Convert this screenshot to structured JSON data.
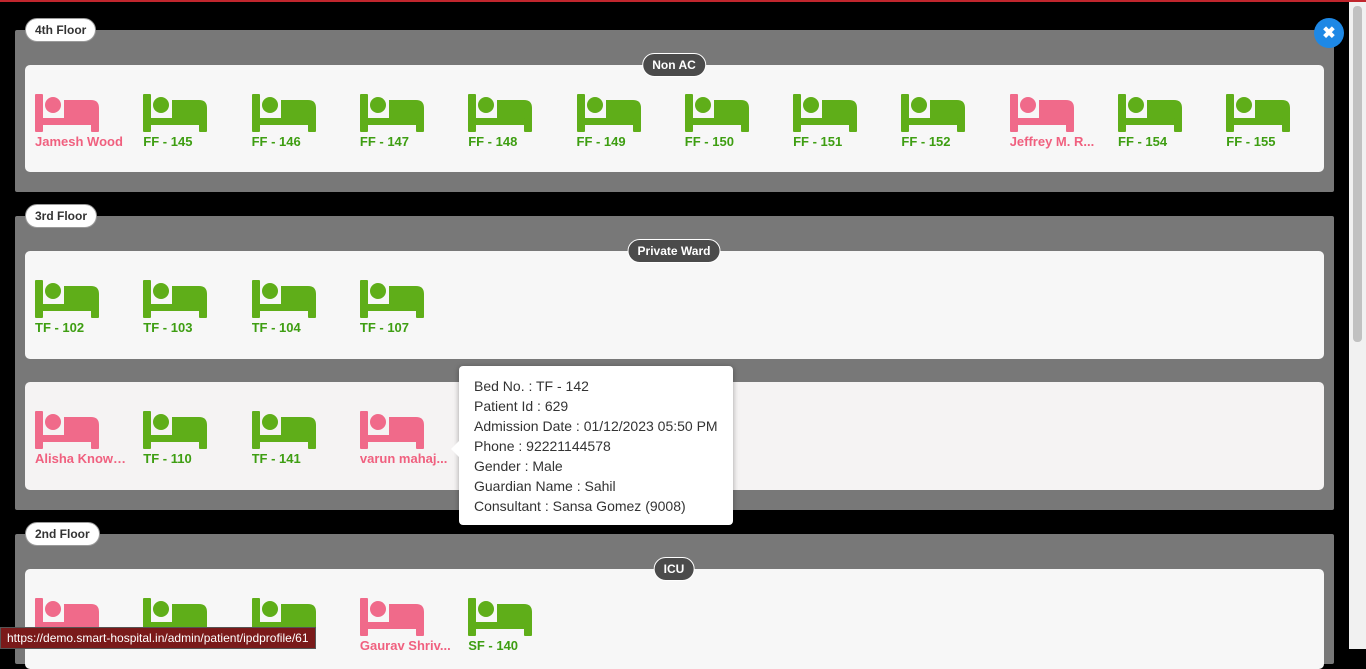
{
  "floors": [
    {
      "name": "4th Floor",
      "wards": [
        {
          "name": "Non AC",
          "beds": [
            {
              "label": "Jamesh Wood",
              "status": "occupied"
            },
            {
              "label": "FF - 145",
              "status": "available"
            },
            {
              "label": "FF - 146",
              "status": "available"
            },
            {
              "label": "FF - 147",
              "status": "available"
            },
            {
              "label": "FF - 148",
              "status": "available"
            },
            {
              "label": "FF - 149",
              "status": "available"
            },
            {
              "label": "FF - 150",
              "status": "available"
            },
            {
              "label": "FF - 151",
              "status": "available"
            },
            {
              "label": "FF - 152",
              "status": "available"
            },
            {
              "label": "Jeffrey M. R...",
              "status": "occupied"
            },
            {
              "label": "FF - 154",
              "status": "available"
            },
            {
              "label": "FF - 155",
              "status": "available"
            }
          ]
        }
      ]
    },
    {
      "name": "3rd Floor",
      "wards": [
        {
          "name": "Private Ward",
          "beds": [
            {
              "label": "TF - 102",
              "status": "available"
            },
            {
              "label": "TF - 103",
              "status": "available"
            },
            {
              "label": "TF - 104",
              "status": "available"
            },
            {
              "label": "TF - 107",
              "status": "available"
            }
          ]
        },
        {
          "name": "",
          "beds": [
            {
              "label": "Alisha Knowl...",
              "status": "occupied"
            },
            {
              "label": "TF - 110",
              "status": "available"
            },
            {
              "label": "TF - 141",
              "status": "available"
            },
            {
              "label": "varun mahaj...",
              "status": "occupied"
            }
          ]
        }
      ]
    },
    {
      "name": "2nd Floor",
      "wards": [
        {
          "name": "ICU",
          "beds": [
            {
              "label": "",
              "status": "occupied"
            },
            {
              "label": "",
              "status": "available"
            },
            {
              "label": "",
              "status": "available"
            },
            {
              "label": "Gaurav Shriv...",
              "status": "occupied"
            },
            {
              "label": "SF - 140",
              "status": "available"
            }
          ]
        }
      ]
    }
  ],
  "tooltip": {
    "lines": [
      "Bed No. : TF - 142",
      "Patient Id : 629",
      "Admission Date : 01/12/2023 05:50 PM",
      "Phone : 92221144578",
      "Gender : Male",
      "Guardian Name : Sahil",
      "Consultant : Sansa Gomez (9008)"
    ]
  },
  "close_button": {
    "icon": "close-icon",
    "label": "✖"
  },
  "status_url": "https://demo.smart-hospital.in/admin/patient/ipdprofile/61",
  "colors": {
    "available": "#5fae19",
    "occupied": "#f06a8a",
    "floor_bg": "#787878",
    "close_btn": "#1e88e5"
  }
}
